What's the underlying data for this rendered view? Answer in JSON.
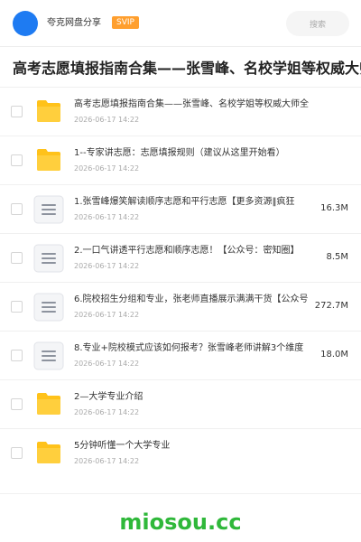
{
  "header": {
    "share_name": "夸克网盘分享",
    "vip_label": "SVIP",
    "search_label": "搜索"
  },
  "folder_title": "高考志愿填报指南合集——张雪峰、名校学姐等权威大师全",
  "items": [
    {
      "type": "folder",
      "name": "高考志愿填报指南合集——张雪峰、名校学姐等权威大师全",
      "date": "2026-06-17 14:22",
      "size": ""
    },
    {
      "type": "folder",
      "name": "1--专家讲志愿：志愿填报规则（建议从这里开始看）",
      "date": "2026-06-17 14:22",
      "size": ""
    },
    {
      "type": "file",
      "name": "1.张雪峰爆笑解读顺序志愿和平行志愿【更多资源‖疯狂",
      "date": "2026-06-17 14:22",
      "size": "16.3M"
    },
    {
      "type": "file",
      "name": "2.一口气讲透平行志愿和顺序志愿！【公众号：密知圈】",
      "date": "2026-06-17 14:22",
      "size": "8.5M"
    },
    {
      "type": "file",
      "name": "6.院校招生分组和专业，张老师直播展示满满干货【公众号",
      "date": "2026-06-17 14:22",
      "size": "272.7M"
    },
    {
      "type": "file",
      "name": "8.专业+院校模式应该如何报考？张雪峰老师讲解3个维度",
      "date": "2026-06-17 14:22",
      "size": "18.0M"
    },
    {
      "type": "folder",
      "name": "2—大学专业介绍",
      "date": "2026-06-17 14:22",
      "size": ""
    },
    {
      "type": "folder",
      "name": "5分钟听懂一个大学专业",
      "date": "2026-06-17 14:22",
      "size": ""
    }
  ],
  "watermark": "miosou.cc",
  "colors": {
    "avatar": "#1e7bf2",
    "vip": "#ff9f2e",
    "folder": "#ffc21a",
    "watermark": "#2fb83a"
  }
}
